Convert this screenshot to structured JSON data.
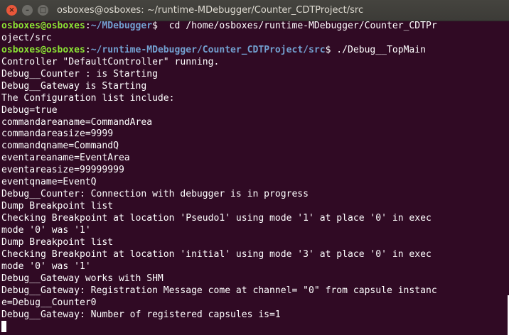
{
  "window": {
    "title": "osboxes@osboxes: ~/runtime-MDebugger/Counter_CDTProject/src"
  },
  "titlebar_buttons": {
    "close": "×",
    "minimize": "–",
    "maximize": "□"
  },
  "terminal": {
    "prompt1": {
      "user": "osboxes@osboxes",
      "sep": ":",
      "path": "~/MDebugger",
      "symbol": "$",
      "command": "  cd /home/osboxes/runtime-MDebugger/Counter_CDTPr"
    },
    "prompt1_wrap": "oject/src",
    "prompt2": {
      "user": "osboxes@osboxes",
      "sep": ":",
      "path": "~/runtime-MDebugger/Counter_CDTProject/src",
      "symbol": "$",
      "command": " ./Debug__TopMain"
    },
    "output": [
      "Controller \"DefaultController\" running.",
      "Debug__Counter : is Starting",
      "Debug__Gateway is Starting",
      "The Configuration list include:",
      "Debug=true",
      "commandareaname=CommandArea",
      "commandareasize=9999",
      "commandqname=CommandQ",
      "eventareaname=EventArea",
      "eventareasize=99999999",
      "eventqname=EventQ",
      "Debug__Counter: Connection with debugger is in progress",
      "Dump Breakpoint list",
      "Checking Breakpoint at location 'Pseudo1' using mode '1' at place '0' in exec",
      "mode '0' was '1'",
      "Dump Breakpoint list",
      "Checking Breakpoint at location 'initial' using mode '3' at place '0' in exec",
      "mode '0' was '1'",
      "Debug__Gateway works with SHM",
      "Debug__Gateway: Registration Message come at channel= \"0\" from capsule instanc",
      "e=Debug__Counter0",
      "Debug__Gateway: Number of registered capsules is=1"
    ]
  },
  "colors": {
    "terminal_bg": "#300a24",
    "user_host": "#8ae234",
    "path": "#729fcf",
    "text": "#ffffff",
    "close_button": "#e9573a"
  }
}
